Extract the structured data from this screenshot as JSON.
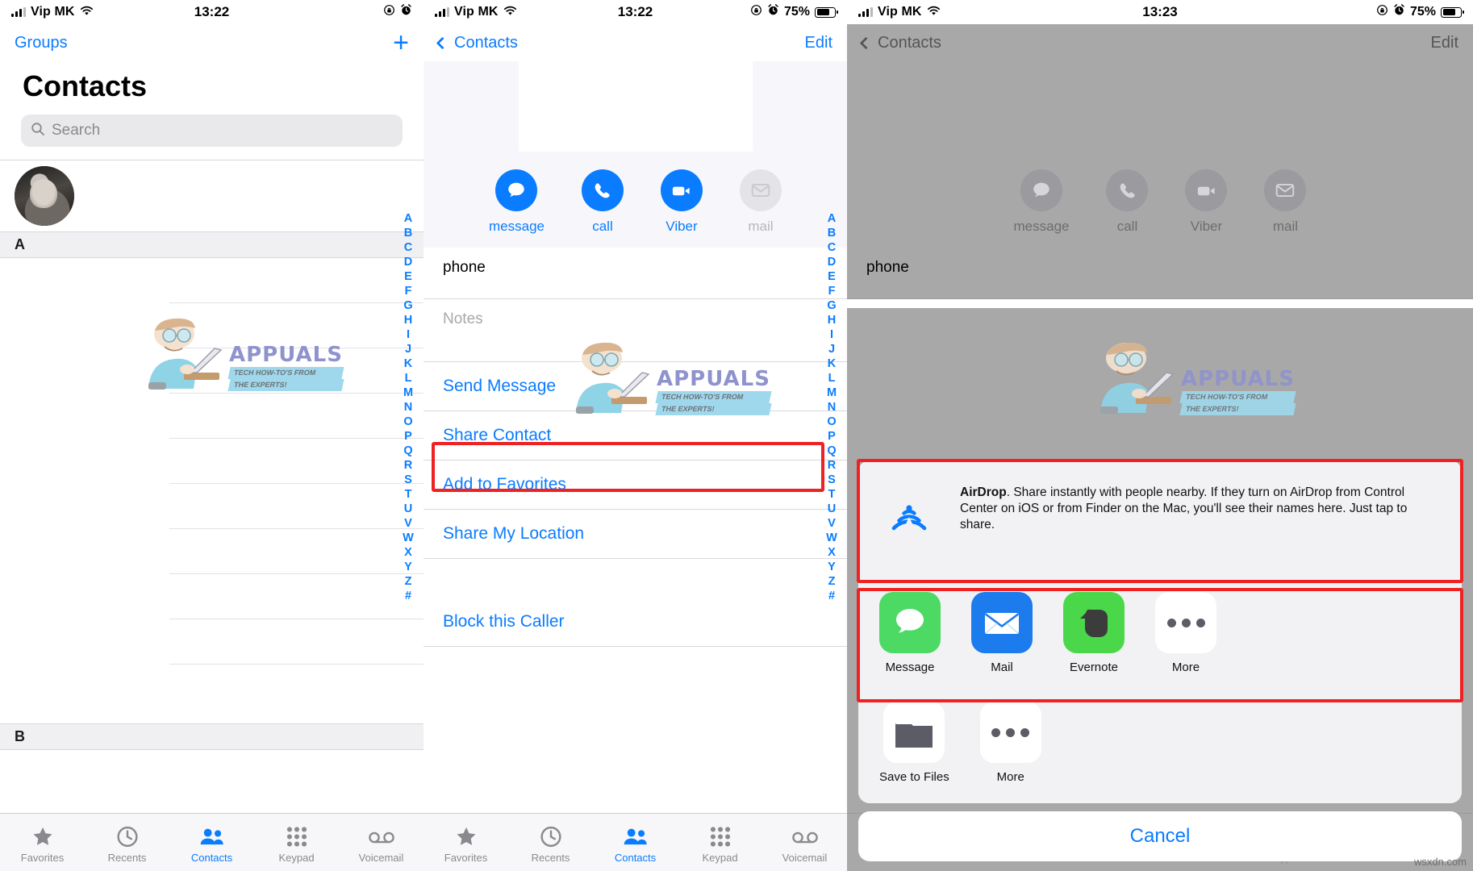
{
  "status_bar": {
    "carrier": "Vip MK",
    "time_1": "13:22",
    "time_2": "13:22",
    "time_3": "13:23",
    "battery_percent": "75%",
    "wifi_icon": "wifi-icon",
    "signal_icon": "cellular-signal-icon",
    "rotation_lock_icon": "rotation-lock-icon",
    "alarm_icon": "alarm-clock-icon",
    "battery_icon": "battery-icon"
  },
  "panel1": {
    "nav": {
      "groups_label": "Groups",
      "add_label": "+"
    },
    "title": "Contacts",
    "search": {
      "placeholder": "Search",
      "icon": "search-icon"
    },
    "section_header_a": "A",
    "section_header_b": "B",
    "index": [
      "A",
      "B",
      "C",
      "D",
      "E",
      "F",
      "G",
      "H",
      "I",
      "J",
      "K",
      "L",
      "M",
      "N",
      "O",
      "P",
      "Q",
      "R",
      "S",
      "T",
      "U",
      "V",
      "W",
      "X",
      "Y",
      "Z",
      "#"
    ]
  },
  "panel2": {
    "nav": {
      "back_label": "Contacts",
      "edit_label": "Edit"
    },
    "actions": [
      {
        "label": "message",
        "icon": "message-bubble-icon",
        "enabled": true
      },
      {
        "label": "call",
        "icon": "phone-handset-icon",
        "enabled": true
      },
      {
        "label": "Viber",
        "icon": "video-camera-icon",
        "enabled": true
      },
      {
        "label": "mail",
        "icon": "envelope-icon",
        "enabled": false
      }
    ],
    "phone_label": "phone",
    "notes_placeholder": "Notes",
    "rows": [
      {
        "label": "Send Message",
        "highlighted": false
      },
      {
        "label": "Share Contact",
        "highlighted": true
      },
      {
        "label": "Add to Favorites",
        "highlighted": false
      },
      {
        "label": "Share My Location",
        "highlighted": false
      },
      {
        "label": "Block this Caller",
        "highlighted": false
      }
    ]
  },
  "panel3": {
    "nav": {
      "back_label": "Contacts",
      "edit_label": "Edit"
    },
    "actions": [
      {
        "label": "message",
        "icon": "message-bubble-icon"
      },
      {
        "label": "call",
        "icon": "phone-handset-icon"
      },
      {
        "label": "Viber",
        "icon": "video-camera-icon"
      },
      {
        "label": "mail",
        "icon": "envelope-icon"
      }
    ],
    "phone_label": "phone",
    "airdrop": {
      "icon": "airdrop-icon",
      "title": "AirDrop",
      "text": ". Share instantly with people nearby. If they turn on AirDrop from Control Center on iOS or from Finder on the Mac, you'll see their names here. Just tap to share."
    },
    "apps_row_1": [
      {
        "label": "Message",
        "icon": "messages-app-icon",
        "color": "#4cd964"
      },
      {
        "label": "Mail",
        "icon": "mail-app-icon",
        "color": "#1c7ced"
      },
      {
        "label": "Evernote",
        "icon": "evernote-app-icon",
        "color": "#4ad84a"
      },
      {
        "label": "More",
        "icon": "more-dots-icon",
        "color": "#ffffff"
      }
    ],
    "apps_row_2": [
      {
        "label": "Save to Files",
        "icon": "folder-icon",
        "color": "#ffffff"
      },
      {
        "label": "More",
        "icon": "more-dots-icon",
        "color": "#ffffff"
      }
    ],
    "cancel_label": "Cancel"
  },
  "tabbar": {
    "items": [
      {
        "label": "Favorites",
        "icon": "star-icon",
        "active": false
      },
      {
        "label": "Recents",
        "icon": "clock-icon",
        "active": false
      },
      {
        "label": "Contacts",
        "icon": "people-icon",
        "active": true
      },
      {
        "label": "Keypad",
        "icon": "keypad-icon",
        "active": false
      },
      {
        "label": "Voicemail",
        "icon": "voicemail-icon",
        "active": false
      }
    ]
  },
  "watermark": {
    "brand": "APPUALS",
    "tagline_1": "TECH HOW-TO'S FROM",
    "tagline_2": "THE EXPERTS!"
  },
  "footer_credit": "wsxdn.com",
  "colors": {
    "accent_blue": "#0a7cff",
    "highlight_red": "#ee2222",
    "tab_active": "#0a7cff"
  }
}
